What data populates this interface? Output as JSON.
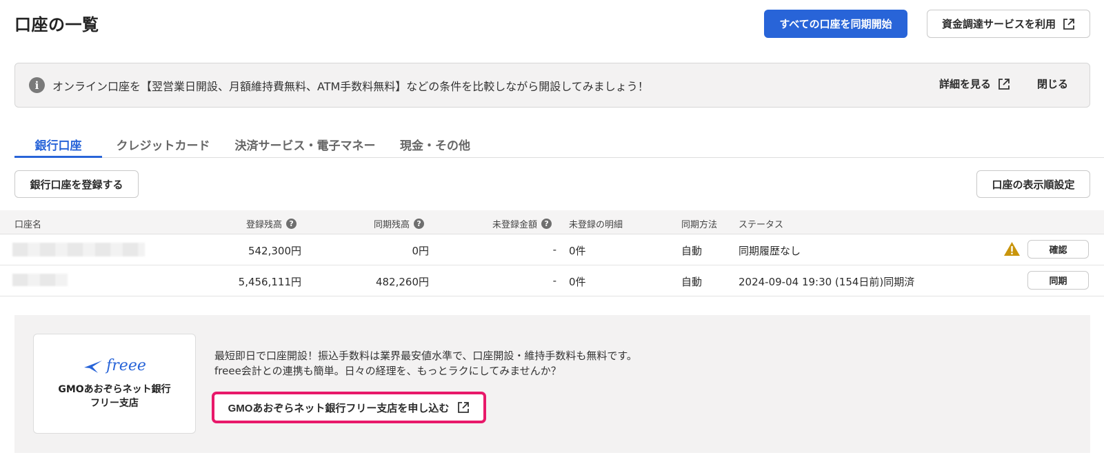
{
  "page": {
    "title": "口座の一覧"
  },
  "header": {
    "sync_all_label": "すべての口座を同期開始",
    "funding_label": "資金調達サービスを利用"
  },
  "banner": {
    "text": "オンライン口座を【翌営業日開設、月額維持費無料、ATM手数料無料】などの条件を比較しながら開設してみましょう！",
    "detail_label": "詳細を見る",
    "close_label": "閉じる"
  },
  "tabs": [
    {
      "label": "銀行口座",
      "active": true
    },
    {
      "label": "クレジットカード",
      "active": false
    },
    {
      "label": "決済サービス・電子マネー",
      "active": false
    },
    {
      "label": "現金・その他",
      "active": false
    }
  ],
  "actions": {
    "register_label": "銀行口座を登録する",
    "order_label": "口座の表示順設定"
  },
  "table": {
    "columns": {
      "name": "口座名",
      "registered_balance": "登録残高",
      "synced_balance": "同期残高",
      "unregistered_amount": "未登録金額",
      "unregistered_items": "未登録の明細",
      "sync_method": "同期方法",
      "status": "ステータス"
    },
    "rows": [
      {
        "registered_balance": "542,300円",
        "synced_balance": "0円",
        "unregistered_amount": "-",
        "unregistered_items": "0件",
        "sync_method": "自動",
        "status": "同期履歴なし",
        "warning": true,
        "action_label": "確認"
      },
      {
        "registered_balance": "5,456,111円",
        "synced_balance": "482,260円",
        "unregistered_amount": "-",
        "unregistered_items": "0件",
        "sync_method": "自動",
        "status": "2024-09-04 19:30 (154日前)同期済",
        "warning": false,
        "action_label": "同期"
      }
    ]
  },
  "promo": {
    "logo_text": "freee",
    "bank_name_line1": "GMOあおぞらネット銀行",
    "bank_name_line2": "フリー支店",
    "text_line1": "最短即日で口座開設！振込手数料は業界最安値水準で、口座開設・維持手数料も無料です。",
    "text_line2": "freee会計との連携も簡単。日々の経理を、もっとラクにしてみませんか？",
    "apply_label": "GMOあおぞらネット銀行フリー支店を申し込む"
  },
  "colors": {
    "primary": "#2864d8",
    "highlight": "#e8196a",
    "warning": "#c9950c"
  }
}
